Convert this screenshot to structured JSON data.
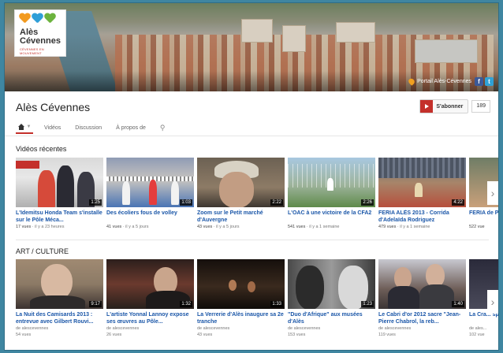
{
  "banner": {
    "logo_line1": "Alès",
    "logo_line2": "Cévennes",
    "logo_tagline": "CÉVENNES EN MOUVEMENT",
    "portal_link": "Portail Alès-Cévennes",
    "social": [
      "f",
      "t"
    ]
  },
  "channel": {
    "title": "Alès Cévennes",
    "subscribe_label": "S'abonner",
    "subscriber_count": "189"
  },
  "tabs": [
    "Vidéos",
    "Discussion",
    "À propos de"
  ],
  "sections": [
    {
      "title": "Vidéos récentes",
      "videos": [
        {
          "title": "L'Idemitsu Honda Team s'installe sur le Pôle Méca...",
          "duration": "1:25",
          "views": "17 vues",
          "age": "il y a 23 heures"
        },
        {
          "title": "Des écoliers fous de volley",
          "duration": "1:03",
          "views": "41 vues",
          "age": "il y a 5 jours"
        },
        {
          "title": "Zoom sur le Petit marché d'Auvergne",
          "duration": "2:22",
          "views": "43 vues",
          "age": "il y a 5 jours"
        },
        {
          "title": "L'OAC à une victoire de la CFA2",
          "duration": "2:26",
          "views": "541 vues",
          "age": "il y a 1 semaine"
        },
        {
          "title": "FERIA ALÈS 2013 - Corrida d'Adelaïda Rodriguez",
          "duration": "4:22",
          "views": "479 vues",
          "age": "il y a 1 semaine"
        },
        {
          "title": "FERIA de Pri...",
          "duration": "",
          "views": "522 vue",
          "age": ""
        }
      ]
    },
    {
      "title": "ART / CULTURE",
      "videos": [
        {
          "title": "La Nuit des Camisards 2013 : entrevue avec Gilbert Rouvi...",
          "duration": "9:17",
          "by": "de alescevennes",
          "views": "54 vues"
        },
        {
          "title": "L'artiste Yonnal Lannoy expose ses œuvres au Pôle...",
          "duration": "1:32",
          "by": "de alescevennes",
          "views": "26 vues"
        },
        {
          "title": "La Verrerie d'Alès inaugure sa 2e tranche",
          "duration": "1:33",
          "by": "de alescevennes",
          "views": "43 vues"
        },
        {
          "title": "\"Duo d'Afrique\" aux musées d'Alès",
          "duration": "1:23",
          "by": "de alescevennes",
          "views": "153 vues"
        },
        {
          "title": "Le Cabri d'or 2012 sacre \"Jean-Pierre Chabrol, la reb...",
          "duration": "1:40",
          "by": "de alescevennes",
          "views": "119 vues"
        },
        {
          "title": "La Cra... specta...",
          "duration": "",
          "by": "de ales...",
          "views": "102 vue"
        }
      ]
    }
  ],
  "colors": {
    "accent": "#c4302b",
    "link": "#1a56a8",
    "page_bg": "#3f86a1"
  }
}
